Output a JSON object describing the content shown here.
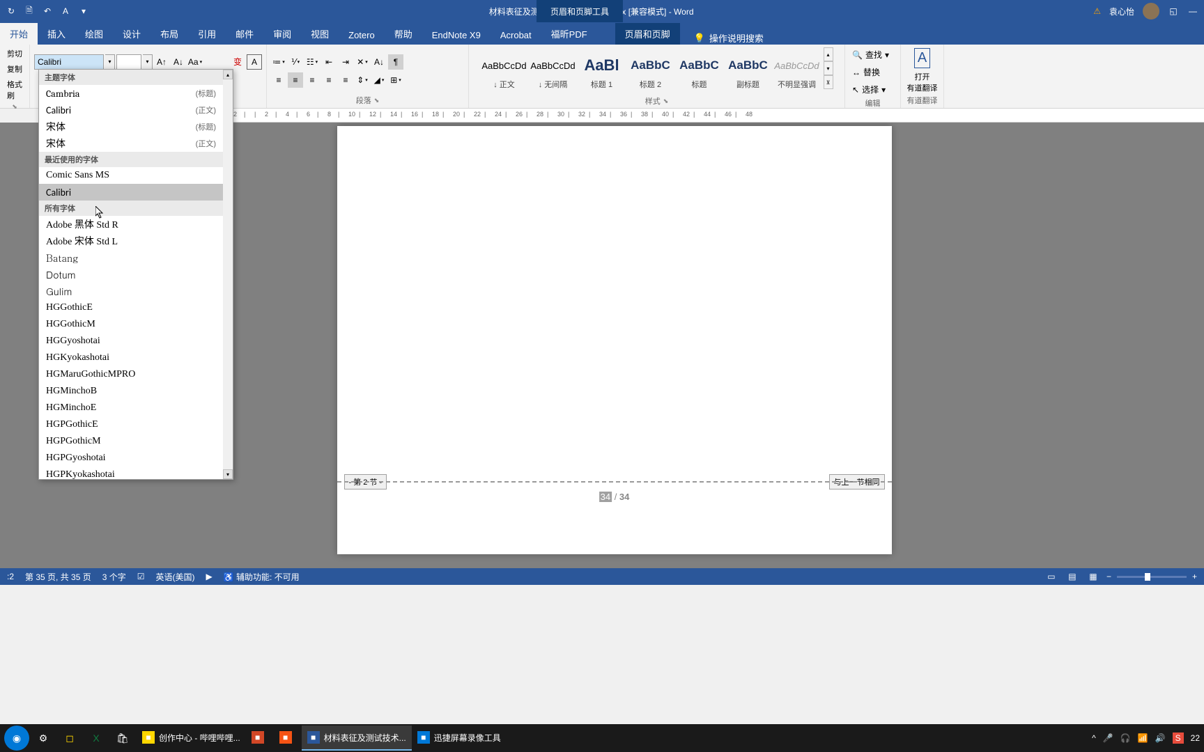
{
  "title_bar": {
    "document_title": "材料表征及测试技术实验指导书.docx [兼容模式] - Word",
    "context_tool": "页眉和页脚工具",
    "user_name": "袁心怡"
  },
  "ribbon": {
    "tabs": [
      "开始",
      "插入",
      "绘图",
      "设计",
      "布局",
      "引用",
      "邮件",
      "审阅",
      "视图",
      "Zotero",
      "帮助",
      "EndNote X9",
      "Acrobat",
      "福昕PDF"
    ],
    "context_tab": "页眉和页脚",
    "tell_me": "操作说明搜索",
    "clipboard": {
      "cut": "剪切",
      "copy": "复制",
      "painter": "格式刷"
    },
    "font": {
      "name_value": "Calibri",
      "size_value": ""
    },
    "paragraph_label": "段落",
    "styles": [
      {
        "preview": "AaBbCcDd",
        "name": "↓ 正文",
        "cls": ""
      },
      {
        "preview": "AaBbCcDd",
        "name": "↓ 无间隔",
        "cls": ""
      },
      {
        "preview": "AaBl",
        "name": "标题 1",
        "cls": "big"
      },
      {
        "preview": "AaBbC",
        "name": "标题 2",
        "cls": "med"
      },
      {
        "preview": "AaBbC",
        "name": "标题",
        "cls": "med"
      },
      {
        "preview": "AaBbC",
        "name": "副标题",
        "cls": "med"
      },
      {
        "preview": "AaBbCcDd",
        "name": "不明显强调",
        "cls": "italic"
      }
    ],
    "styles_label": "样式",
    "editing": {
      "find": "查找",
      "replace": "替换",
      "select": "选择",
      "label": "编辑"
    },
    "translate": {
      "line1": "打开",
      "line2": "有道翻译",
      "label": "有道翻译"
    }
  },
  "font_dropdown": {
    "header_theme": "主题字体",
    "theme_fonts": [
      {
        "name": "Cambria",
        "tag": "(标题)"
      },
      {
        "name": "Calibri",
        "tag": "(正文)"
      },
      {
        "name": "宋体",
        "tag": "(标题)"
      },
      {
        "name": "宋体",
        "tag": "(正文)"
      }
    ],
    "header_recent": "最近使用的字体",
    "recent_fonts": [
      {
        "name": "Comic Sans MS"
      },
      {
        "name": "Calibri",
        "selected": true
      }
    ],
    "header_all": "所有字体",
    "all_fonts": [
      "Adobe 黑体 Std R",
      "Adobe 宋体 Std L",
      "Batang",
      "Dotum",
      "Gulim",
      "HGGothicE",
      "HGGothicM",
      "HGGyoshotai",
      "HGKyokashotai",
      "HGMaruGothicMPRO",
      "HGMinchoB",
      "HGMinchoE",
      "HGPGothicE",
      "HGPGothicM",
      "HGPGyoshotai",
      "HGPKyokashotai"
    ]
  },
  "ruler_marks": [
    "2",
    "|",
    "|",
    "2",
    "|",
    "4",
    "|",
    "6",
    "|",
    "8",
    "|",
    "10",
    "|",
    "12",
    "|",
    "14",
    "|",
    "16",
    "|",
    "18",
    "|",
    "20",
    "|",
    "22",
    "|",
    "24",
    "|",
    "26",
    "|",
    "28",
    "|",
    "30",
    "|",
    "32",
    "|",
    "34",
    "|",
    "36",
    "|",
    "38",
    "|",
    "40",
    "|",
    "42",
    "|",
    "44",
    "|",
    "46",
    "|",
    "48"
  ],
  "page": {
    "section_label": "- 第 2 节 -",
    "same_as_prev": "与上一节相同",
    "page_num_sel": "34",
    "page_num_sep": " / ",
    "page_num_total": "34"
  },
  "status_bar": {
    "section": ":2",
    "page": "第 35 页, 共 35 页",
    "words": "3 个字",
    "language": "英语(美国)",
    "accessibility": "辅助功能: 不可用"
  },
  "taskbar": {
    "apps": [
      {
        "label": "创作中心 - 哔哩哔哩...",
        "color": "#FFD700"
      },
      {
        "label": "",
        "color": "#D24726"
      },
      {
        "label": "",
        "color": "#F65314"
      },
      {
        "label": "材料表征及测试技术...",
        "color": "#2B579A",
        "active": true
      },
      {
        "label": "迅捷屏幕录像工具",
        "color": "#0078D7"
      }
    ],
    "time": "22"
  }
}
